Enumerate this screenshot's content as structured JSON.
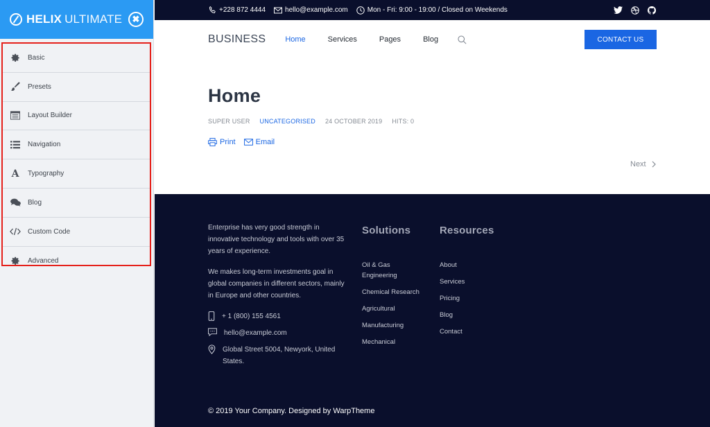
{
  "sidebar": {
    "logo_bold": "HELIX",
    "logo_light": "ULTIMATE",
    "close_glyph": "✖",
    "items": [
      {
        "label": "Basic",
        "icon": "gear-icon"
      },
      {
        "label": "Presets",
        "icon": "brush-icon"
      },
      {
        "label": "Layout Builder",
        "icon": "layout-icon"
      },
      {
        "label": "Navigation",
        "icon": "list-icon"
      },
      {
        "label": "Typography",
        "icon": "font-icon"
      },
      {
        "label": "Blog",
        "icon": "comments-icon"
      },
      {
        "label": "Custom Code",
        "icon": "code-icon"
      },
      {
        "label": "Advanced",
        "icon": "gear-icon"
      }
    ],
    "highlight_color": "#e5201a",
    "header_color": "#2b9af3"
  },
  "topbar": {
    "phone": "+228 872 4444",
    "email": "hello@example.com",
    "hours": "Mon - Fri: 9:00 - 19:00 / Closed on Weekends",
    "social": [
      "twitter-icon",
      "dribbble-icon",
      "github-icon"
    ]
  },
  "header": {
    "brand": "BUSINESS",
    "nav": [
      {
        "label": "Home",
        "active": true
      },
      {
        "label": "Services",
        "active": false
      },
      {
        "label": "Pages",
        "active": false
      },
      {
        "label": "Blog",
        "active": false
      }
    ],
    "contact_button": "CONTACT US",
    "accent_color": "#1a66e3"
  },
  "article": {
    "title": "Home",
    "author": "SUPER USER",
    "category": "UNCATEGORISED",
    "date": "24 OCTOBER 2019",
    "hits": "HITS: 0",
    "print_label": "Print",
    "email_label": "Email",
    "next_label": "Next"
  },
  "footer": {
    "about": [
      "Enterprise has very good strength in innovative technology and tools with over 35 years of experience.",
      "We makes long-term investments goal in global companies in different sectors, mainly in Europe and other countries."
    ],
    "phone": "+ 1 (800) 155 4561",
    "email": "hello@example.com",
    "address": "Global Street 5004, Newyork, United States.",
    "solutions": {
      "title": "Solutions",
      "links": [
        "Oil & Gas Engineering",
        "Chemical Research",
        "Agricultural",
        "Manufacturing",
        "Mechanical"
      ]
    },
    "resources": {
      "title": "Resources",
      "links": [
        "About",
        "Services",
        "Pricing",
        "Blog",
        "Contact"
      ]
    },
    "copyright": "© 2019 Your Company. Designed by WarpTheme",
    "background_color": "#0a0f2c"
  }
}
